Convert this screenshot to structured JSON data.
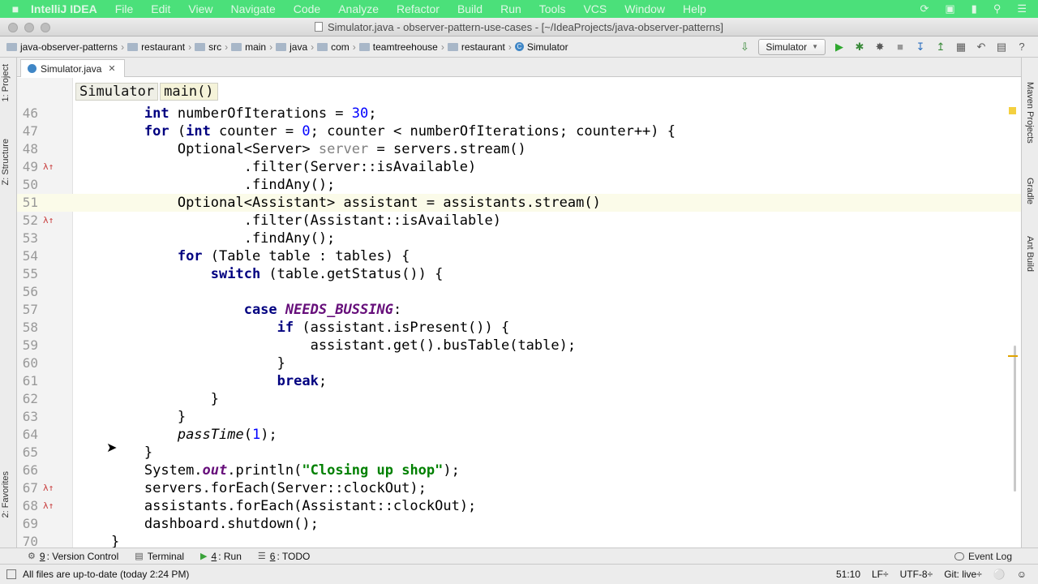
{
  "menubar": {
    "app_name": "IntelliJ IDEA",
    "items": [
      "File",
      "Edit",
      "View",
      "Navigate",
      "Code",
      "Analyze",
      "Refactor",
      "Build",
      "Run",
      "Tools",
      "VCS",
      "Window",
      "Help"
    ]
  },
  "window": {
    "title": "Simulator.java - observer-pattern-use-cases - [~/IdeaProjects/java-observer-patterns]"
  },
  "breadcrumbs": [
    {
      "label": "java-observer-patterns",
      "icon": "folder-icon"
    },
    {
      "label": "restaurant",
      "icon": "folder-icon"
    },
    {
      "label": "src",
      "icon": "folder-icon"
    },
    {
      "label": "main",
      "icon": "folder-icon"
    },
    {
      "label": "java",
      "icon": "folder-icon"
    },
    {
      "label": "com",
      "icon": "folder-icon"
    },
    {
      "label": "teamtreehouse",
      "icon": "folder-icon"
    },
    {
      "label": "restaurant",
      "icon": "folder-icon"
    },
    {
      "label": "Simulator",
      "icon": "class-icon"
    }
  ],
  "run_config": "Simulator",
  "tab": {
    "label": "Simulator.java"
  },
  "editor_crumbs": [
    "Simulator",
    "main()"
  ],
  "left_tools": [
    "1: Project",
    "Z: Structure",
    "2: Favorites"
  ],
  "right_tools": [
    "Maven Projects",
    "Gradle",
    "Ant Build"
  ],
  "bottom_tools": [
    {
      "key": "9",
      "label": ": Version Control"
    },
    {
      "key": "",
      "label": "Terminal"
    },
    {
      "key": "4",
      "label": ": Run"
    },
    {
      "key": "6",
      "label": ": TODO"
    }
  ],
  "event_log": "Event Log",
  "status": {
    "message": "All files are up-to-date (today 2:24 PM)",
    "position": "51:10",
    "line_sep": "LF÷",
    "encoding": "UTF-8÷",
    "git": "Git: live÷"
  },
  "code": {
    "line_numbers": [
      "46",
      "47",
      "48",
      "49",
      "50",
      "51",
      "52",
      "53",
      "54",
      "55",
      "56",
      "57",
      "58",
      "59",
      "60",
      "61",
      "62",
      "63",
      "64",
      "65",
      "66",
      "67",
      "68",
      "69",
      "70"
    ],
    "l46_a": "int",
    "l46_b": " numberOfIterations = ",
    "l46_c": "30",
    "l46_d": ";",
    "l47_a": "for",
    "l47_b": " (",
    "l47_c": "int",
    "l47_d": " counter = ",
    "l47_e": "0",
    "l47_f": "; counter < numberOfIterations; counter++) {",
    "l48_a": "Optional<Server> ",
    "l48_b": "server",
    "l48_c": " = servers.stream()",
    "l49": ".filter(Server::isAvailable)",
    "l50": ".findAny();",
    "l51": "Optional<Assistant> assistant = assistants.stream()",
    "l52": ".filter(Assistant::isAvailable)",
    "l53": ".findAny();",
    "l54_a": "for",
    "l54_b": " (Table table : tables) {",
    "l55_a": "switch",
    "l55_b": " (table.getStatus()) {",
    "l57_a": "case",
    "l57_b": " ",
    "l57_c": "NEEDS_BUSSING",
    "l57_d": ":",
    "l58_a": "if",
    "l58_b": " (assistant.isPresent()) {",
    "l59": "assistant.get().busTable(table);",
    "l60": "}",
    "l61_a": "break",
    "l61_b": ";",
    "l62": "}",
    "l63": "}",
    "l64_a": "passTime",
    "l64_b": "(",
    "l64_c": "1",
    "l64_d": ");",
    "l65": "}",
    "l66_a": "System.",
    "l66_b": "out",
    "l66_c": ".println(",
    "l66_d": "\"Closing up shop\"",
    "l66_e": ");",
    "l67": "servers.forEach(Server::clockOut);",
    "l68": "assistants.forEach(Assistant::clockOut);",
    "l69": "dashboard.shutdown();",
    "l70": "}"
  }
}
